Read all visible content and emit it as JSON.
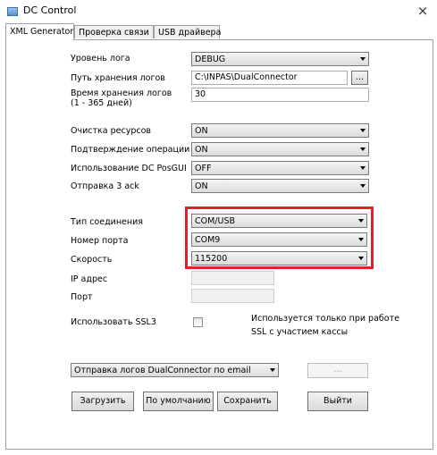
{
  "window": {
    "title": "DC Control",
    "close_glyph": "×",
    "icon": "window-app-icon"
  },
  "tabs": [
    {
      "label": "XML Generator",
      "active": true
    },
    {
      "label": "Проверка связи",
      "active": false
    },
    {
      "label": "USB драйвера",
      "active": false
    }
  ],
  "form": {
    "log_level": {
      "label": "Уровень лога",
      "value": "DEBUG"
    },
    "log_path": {
      "label": "Путь хранения логов",
      "value": "C:\\INPAS\\DualConnector",
      "browse_label": "..."
    },
    "log_retention": {
      "label_line1": "Время хранения логов",
      "label_line2": "(1 - 365 дней)",
      "value": "30"
    },
    "resource_cleanup": {
      "label": "Очистка ресурсов",
      "value": "ON"
    },
    "operation_confirm": {
      "label": "Подтверждение операции",
      "value": "ON"
    },
    "use_posgui": {
      "label": "Использование DC PosGUI",
      "value": "OFF"
    },
    "send_ack": {
      "label": "Отправка 3 ack",
      "value": "ON"
    },
    "connection_type": {
      "label": "Тип соединения",
      "value": "COM/USB"
    },
    "port_number": {
      "label": "Номер порта",
      "value": "COM9"
    },
    "speed": {
      "label": "Скорость",
      "value": "115200"
    },
    "ip_address": {
      "label": "IP адрес",
      "value": ""
    },
    "port": {
      "label": "Порт",
      "value": ""
    },
    "ssl3": {
      "label": "Использовать SSL3",
      "checked": false,
      "note_line1": "Используется только при работе",
      "note_line2": "SSL с участием кассы"
    },
    "email_logs": {
      "value": "Отправка логов DualConnector по email",
      "extra_label": "..."
    }
  },
  "buttons": {
    "load": "Загрузить",
    "defaults": "По умолчанию",
    "save": "Сохранить",
    "exit": "Выйти"
  },
  "colors": {
    "highlight": "#e0232b"
  }
}
